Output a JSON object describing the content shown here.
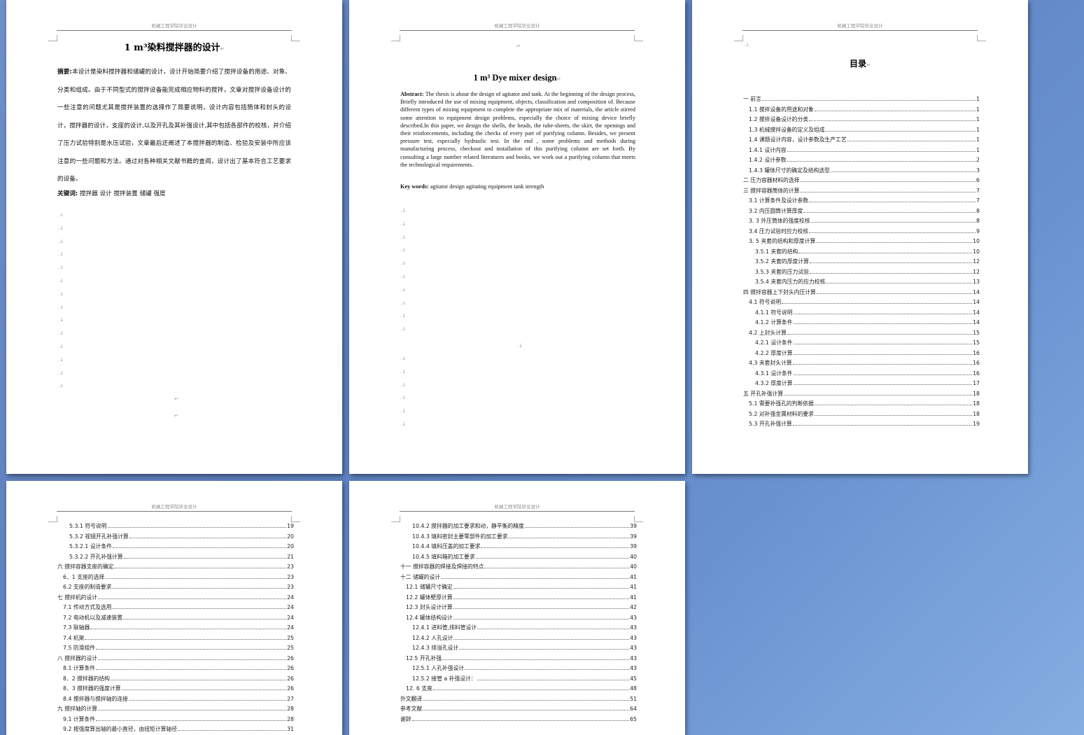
{
  "header_text": "机械工程学院毕业设计",
  "para_mark": "↵",
  "small_mark": ".↓",
  "page1": {
    "title": "1 m³染料搅拌器的设计",
    "abstract_label": "摘要:",
    "abstract_text": "本设计是染料搅拌器和储罐的设计，设计开始简要介绍了搅拌设备的用途、对象、分类和组成。由于不同型式的搅拌设备能完成相应物料的搅拌，文章对搅拌设备设计的一些注意的问题尤其是搅拌装置的选择作了简要说明，设计内容包括筒体和封头的设计，搅拌器的设计，支座的设计,以及开孔及其补强设计,其中包括各部件的校核，并介绍了压力试验特别是水压试验，文章最后还阐述了本搅拌器的制造、检验及安装中所应该注意的一些问题和方法。通过对各种相关文献书籍的查阅，设计出了基本符合工艺要求的设备。",
    "keywords_label": "关键词:",
    "keywords_text": "搅拌器 设计 搅拌装置 储罐  强度"
  },
  "page2": {
    "title": "1 m³ Dye mixer design",
    "abstract_label": "Abstract:",
    "abstract_text": " The thesis is about the design of agitator and tank. At the beginning of the design process, Briefly introduced the use of mixing equipment, objects, classification and composition of. Because different types of mixing equipment to complete the appropriate mix of materials, the article stirred some attention to equipment design problems, especially the choice of mixing device briefly described.In this paper, we design the shells, the heads, the tube-sheets, the skirt, the openings and their reinforcements, including the checks of every part of purifying column. Besides, we present pressure test, especially hydraulic test. In the end , some problems and methods during manufacturing process, checkout and installation of this purifying column are set forth. By consulting a large number related literatures and books, we work out a purifying column that meets the technological requirements.",
    "keywords_label": "Key words:",
    "keywords_text": " agitator   design   agitating equipment   tank   strength"
  },
  "toc_title": "目录",
  "toc_page3": [
    {
      "t": "一  前言",
      "n": "1",
      "lv": 1
    },
    {
      "t": "1.1 搅拌设备的用途和对象",
      "n": "1",
      "lv": 2
    },
    {
      "t": "1.2 搅拌设备设计的分类",
      "n": "1",
      "lv": 2
    },
    {
      "t": "1.3 机械搅拌设备的定义及组成",
      "n": "1",
      "lv": 2
    },
    {
      "t": "1.4 课题设计内容，设计参数及生产工艺",
      "n": "1",
      "lv": 2
    },
    {
      "t": "1.4.1 设计内容",
      "n": "1",
      "lv": 2
    },
    {
      "t": "1.4.2 设计参数",
      "n": "2",
      "lv": 2
    },
    {
      "t": "1.4.3 罐体尺寸的确定及结构选型",
      "n": "3",
      "lv": 2
    },
    {
      "t": "二  压力容器材料的选择",
      "n": "6",
      "lv": 1
    },
    {
      "t": "三  搅拌容器筒体的计算",
      "n": "7",
      "lv": 1
    },
    {
      "t": "3.1 计算条件及设计参数",
      "n": "7",
      "lv": 2
    },
    {
      "t": "3.2 内压圆筒计算厚度",
      "n": "8",
      "lv": 2
    },
    {
      "t": "3. 3 外压筒体的强度校核",
      "n": "8",
      "lv": 2
    },
    {
      "t": "3.4 压力试验时应力校核",
      "n": "9",
      "lv": 2
    },
    {
      "t": "3. 5 夹套的结构和厚度计算",
      "n": "10",
      "lv": 2
    },
    {
      "t": "3.5.1 夹套的结构",
      "n": "10",
      "lv": 3
    },
    {
      "t": "3.5.2 夹套的厚度计算",
      "n": "12",
      "lv": 3
    },
    {
      "t": "3.5.3 夹套的压力试验",
      "n": "12",
      "lv": 3
    },
    {
      "t": "3.5.4 夹套内压力的应力校核",
      "n": "13",
      "lv": 3
    },
    {
      "t": "四  搅拌容器上下封头内压计算",
      "n": "14",
      "lv": 1
    },
    {
      "t": "4.1 符号说明",
      "n": "14",
      "lv": 2
    },
    {
      "t": "4.1.1 符号说明",
      "n": "14",
      "lv": 3
    },
    {
      "t": "4.1.2 计算条件",
      "n": "14",
      "lv": 3
    },
    {
      "t": "4.2 上封头计算",
      "n": "15",
      "lv": 2
    },
    {
      "t": "4.2.1 设计条件",
      "n": "15",
      "lv": 3
    },
    {
      "t": "4.2.2 厚度计算",
      "n": "16",
      "lv": 3
    },
    {
      "t": "4.3 夹套封头计算",
      "n": "16",
      "lv": 2
    },
    {
      "t": "4.3.1 设计条件",
      "n": "16",
      "lv": 3
    },
    {
      "t": "4.3.2 厚度计算",
      "n": "17",
      "lv": 3
    },
    {
      "t": "五  开孔补强计算",
      "n": "18",
      "lv": 1
    },
    {
      "t": "5.1 需要补强孔的判断依据",
      "n": "18",
      "lv": 2
    },
    {
      "t": "5.2 对补强金属材料的要求",
      "n": "18",
      "lv": 2
    },
    {
      "t": "5.3 开孔补强计算",
      "n": "19",
      "lv": 2
    }
  ],
  "toc_page4": [
    {
      "t": "5.3.1 符号说明",
      "n": "19",
      "lv": 3
    },
    {
      "t": "5.3.2 视镜开孔补强计算",
      "n": "20",
      "lv": 3
    },
    {
      "t": "5.3.2.1 设计条件",
      "n": "20",
      "lv": 3
    },
    {
      "t": "5.3.2.2 开孔补强计算",
      "n": "21",
      "lv": 3
    },
    {
      "t": "六  搅拌容器支座的确定",
      "n": "23",
      "lv": 1
    },
    {
      "t": "6．1 支座的选择",
      "n": "23",
      "lv": 2
    },
    {
      "t": "6.2 支座的制造要求",
      "n": "23",
      "lv": 2
    },
    {
      "t": "七  搅拌机的设计",
      "n": "24",
      "lv": 1
    },
    {
      "t": "7.1 传动方式及选用",
      "n": "24",
      "lv": 2
    },
    {
      "t": "7.2 电动机以及减速装置",
      "n": "24",
      "lv": 2
    },
    {
      "t": "7.3 联轴器",
      "n": "24",
      "lv": 2
    },
    {
      "t": "7.4 机架",
      "n": "25",
      "lv": 2
    },
    {
      "t": "7.5 防滑组件",
      "n": "25",
      "lv": 2
    },
    {
      "t": "八  搅拌器的设计",
      "n": "26",
      "lv": 1
    },
    {
      "t": "8.1 计算条件",
      "n": "26",
      "lv": 2
    },
    {
      "t": "8．2 搅拌器的结构",
      "n": "26",
      "lv": 2
    },
    {
      "t": "8．3 搅拌器的强度计算",
      "n": "26",
      "lv": 2
    },
    {
      "t": "8.4 搅拌器与搅拌轴的连接",
      "n": "27",
      "lv": 2
    },
    {
      "t": "九  搅拌轴的计算",
      "n": "28",
      "lv": 1
    },
    {
      "t": "9.1 计算条件",
      "n": "28",
      "lv": 2
    },
    {
      "t": "9.2 按强度算出轴的最小直径，由扭矩计算轴径",
      "n": "31",
      "lv": 2
    }
  ],
  "toc_page5": [
    {
      "t": "10.4.2 搅拌器的加工要求和动，静平衡的精度",
      "n": "39",
      "lv": 3
    },
    {
      "t": "10.4.3 填料密封主要零部件的加工要求",
      "n": "39",
      "lv": 3
    },
    {
      "t": "10.4.4 填料压盖的加工要求",
      "n": "39",
      "lv": 3
    },
    {
      "t": "10.4.5 填料箱的加工要求",
      "n": "40",
      "lv": 3
    },
    {
      "t": "十一  搅拌容器的焊接及焊接的特点",
      "n": "40",
      "lv": 1
    },
    {
      "t": "十二  储罐的设计",
      "n": "41",
      "lv": 1
    },
    {
      "t": "12.1 储罐尺寸确定",
      "n": "41",
      "lv": 2
    },
    {
      "t": "12.2 罐体壁厚计算",
      "n": "41",
      "lv": 2
    },
    {
      "t": "12.3 封头设计计算",
      "n": "42",
      "lv": 2
    },
    {
      "t": "12.4 罐体结构设计",
      "n": "43",
      "lv": 2
    },
    {
      "t": "12.4.1 进料管,排料管设计",
      "n": "43",
      "lv": 3
    },
    {
      "t": "12.4.2 人孔设计",
      "n": "43",
      "lv": 3
    },
    {
      "t": "12.4.3 排溢孔设计",
      "n": "43",
      "lv": 3
    },
    {
      "t": "12.5 开孔补强",
      "n": "43",
      "lv": 2
    },
    {
      "t": "12.5.1 人孔补强设计",
      "n": "43",
      "lv": 3
    },
    {
      "t": "12.5.2 接管 a 补强设计：",
      "n": "45",
      "lv": 3
    },
    {
      "t": "12. 6 支座",
      "n": "48",
      "lv": 2
    },
    {
      "t": "外文翻译",
      "n": "51",
      "lv": 1
    },
    {
      "t": "参考文献",
      "n": "64",
      "lv": 1
    },
    {
      "t": "谢辞",
      "n": "65",
      "lv": 1
    }
  ]
}
